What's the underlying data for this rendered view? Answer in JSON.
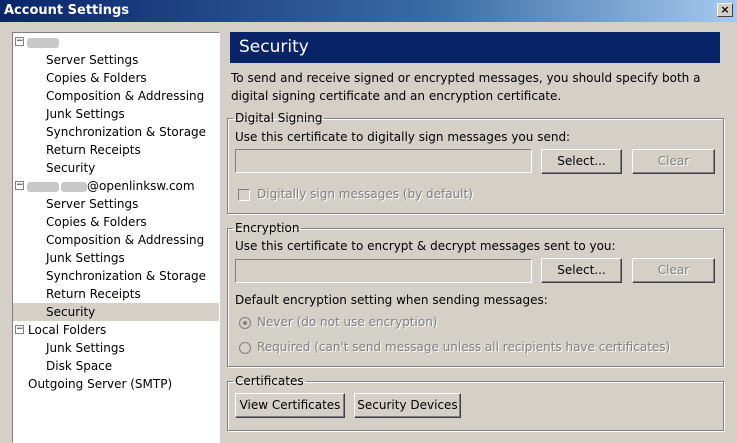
{
  "window": {
    "title": "Account Settings",
    "close_glyph": "×"
  },
  "tree": {
    "account1": {
      "toggle": "⊟",
      "label": ""
    },
    "account1_items": [
      "Server Settings",
      "Copies & Folders",
      "Composition & Addressing",
      "Junk Settings",
      "Synchronization & Storage",
      "Return Receipts",
      "Security"
    ],
    "account2": {
      "toggle": "⊟",
      "label": "@openlinksw.com"
    },
    "account2_items": [
      "Server Settings",
      "Copies & Folders",
      "Composition & Addressing",
      "Junk Settings",
      "Synchronization & Storage",
      "Return Receipts",
      "Security"
    ],
    "local": {
      "toggle": "⊟",
      "label": "Local Folders"
    },
    "local_items": [
      "Junk Settings",
      "Disk Space"
    ],
    "outgoing": "Outgoing Server (SMTP)"
  },
  "page": {
    "title": "Security",
    "intro": "To send and receive signed or encrypted messages, you should specify both a digital signing certificate and an encryption certificate."
  },
  "signing": {
    "legend": "Digital Signing",
    "prompt": "Use this certificate to digitally sign messages you send:",
    "select": "Select...",
    "clear": "Clear",
    "checkbox": "Digitally sign messages (by default)"
  },
  "encryption": {
    "legend": "Encryption",
    "prompt": "Use this certificate to encrypt & decrypt messages sent to you:",
    "select": "Select...",
    "clear": "Clear",
    "default_label": "Default encryption setting when sending messages:",
    "never": "Never (do not use encryption)",
    "required": "Required (can't send message unless all recipients have certificates)"
  },
  "certificates": {
    "legend": "Certificates",
    "view": "View Certificates",
    "devices": "Security Devices"
  }
}
